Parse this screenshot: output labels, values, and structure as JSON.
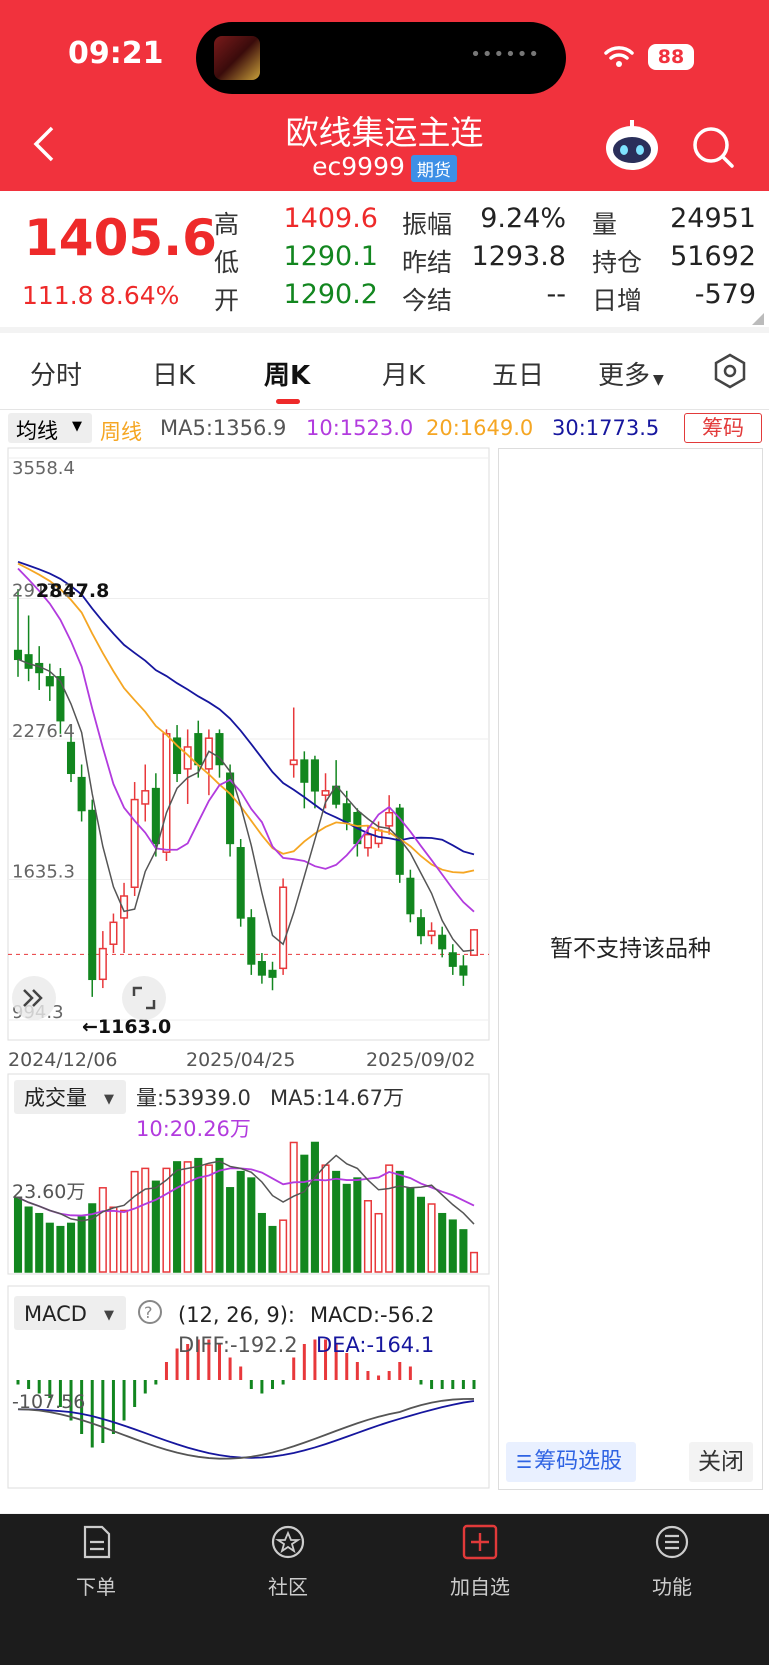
{
  "status_bar": {
    "time": "09:21",
    "battery": "88"
  },
  "header": {
    "title": "欧线集运主连",
    "code": "ec9999",
    "badge": "期货"
  },
  "quote": {
    "price": "1405.6",
    "change": "111.8",
    "change_pct": "8.64%",
    "rows": [
      {
        "l1": "高",
        "v1": "1409.6",
        "l2": "振幅",
        "v2": "9.24%",
        "l3": "量",
        "v3": "24951"
      },
      {
        "l1": "低",
        "v1": "1290.1",
        "l2": "昨结",
        "v2": "1293.8",
        "l3": "持仓",
        "v3": "51692"
      },
      {
        "l1": "开",
        "v1": "1290.2",
        "l2": "今结",
        "v2": "--",
        "l3": "日增",
        "v3": "-579"
      }
    ]
  },
  "tabs": [
    "分时",
    "日K",
    "周K",
    "月K",
    "五日",
    "更多"
  ],
  "ma_bar": {
    "select": "均线",
    "period": "周线",
    "ma5": "MA5:1356.9",
    "ma10": "10:1523.0",
    "ma20": "20:1649.0",
    "ma30": "30:1773.5",
    "chips": "筹码"
  },
  "colors": {
    "brand": "#f1323d",
    "up": "#e8383b",
    "down": "#12861f",
    "ma5": "#555555",
    "ma10": "#b23bde",
    "ma20": "#f5a623",
    "ma30": "#16169e"
  },
  "kline": {
    "y_labels": [
      "3558.4",
      "2917.3",
      "2276.4",
      "1635.3",
      "994.3"
    ],
    "high_marker": "2847.8",
    "low_marker": "←1163.0",
    "dates": [
      "2024/12/06",
      "2025/04/25",
      "2025/09/02"
    ]
  },
  "volume": {
    "select": "成交量",
    "vol": "量:53939.0",
    "ma5": "MA5:14.67万",
    "ma10": "10:20.26万",
    "y_label": "23.60万"
  },
  "macd": {
    "select": "MACD",
    "params": "(12, 26, 9):",
    "macd": "MACD:-56.2",
    "diff": "DIFF:-192.2",
    "dea": "DEA:-164.1",
    "y_label": "-107.56"
  },
  "right_panel": {
    "message": "暂不支持该品种",
    "chip_select": "筹码选股",
    "close": "关闭"
  },
  "nav": [
    {
      "label": "下单",
      "icon": "order-doc-icon"
    },
    {
      "label": "社区",
      "icon": "community-star-icon"
    },
    {
      "label": "加自选",
      "icon": "add-watchlist-icon"
    },
    {
      "label": "功能",
      "icon": "menu-lines-icon"
    }
  ],
  "chart_data": {
    "type": "candlestick",
    "y_range": [
      994.3,
      3558.4
    ],
    "candles": [
      {
        "o": 2680,
        "c": 2640,
        "h": 2960,
        "l": 2560
      },
      {
        "o": 2660,
        "c": 2600,
        "h": 2840,
        "l": 2540
      },
      {
        "o": 2620,
        "c": 2580,
        "h": 2700,
        "l": 2500
      },
      {
        "o": 2560,
        "c": 2520,
        "h": 2620,
        "l": 2450
      },
      {
        "o": 2560,
        "c": 2360,
        "h": 2600,
        "l": 2300
      },
      {
        "o": 2260,
        "c": 2120,
        "h": 2340,
        "l": 2080
      },
      {
        "o": 2100,
        "c": 1950,
        "h": 2160,
        "l": 1900
      },
      {
        "o": 1950,
        "c": 1180,
        "h": 2000,
        "l": 1100
      },
      {
        "o": 1180,
        "c": 1320,
        "h": 1400,
        "l": 1140
      },
      {
        "o": 1340,
        "c": 1440,
        "h": 1480,
        "l": 1300
      },
      {
        "o": 1460,
        "c": 1560,
        "h": 1620,
        "l": 1300
      },
      {
        "o": 1600,
        "c": 2000,
        "h": 2080,
        "l": 1560
      },
      {
        "o": 1980,
        "c": 2040,
        "h": 2160,
        "l": 1900
      },
      {
        "o": 2050,
        "c": 1800,
        "h": 2120,
        "l": 1740
      },
      {
        "o": 1760,
        "c": 2300,
        "h": 2320,
        "l": 1720
      },
      {
        "o": 2280,
        "c": 2120,
        "h": 2340,
        "l": 2080
      },
      {
        "o": 2140,
        "c": 2240,
        "h": 2320,
        "l": 1980
      },
      {
        "o": 2300,
        "c": 2160,
        "h": 2360,
        "l": 2100
      },
      {
        "o": 2140,
        "c": 2280,
        "h": 2320,
        "l": 2020
      },
      {
        "o": 2300,
        "c": 2160,
        "h": 2320,
        "l": 2100
      },
      {
        "o": 2120,
        "c": 1800,
        "h": 2160,
        "l": 1740
      },
      {
        "o": 1780,
        "c": 1460,
        "h": 1820,
        "l": 1420
      },
      {
        "o": 1460,
        "c": 1250,
        "h": 1500,
        "l": 1200
      },
      {
        "o": 1260,
        "c": 1200,
        "h": 1300,
        "l": 1160
      },
      {
        "o": 1220,
        "c": 1190,
        "h": 1260,
        "l": 1130
      },
      {
        "o": 1230,
        "c": 1600,
        "h": 1640,
        "l": 1200
      },
      {
        "o": 2160,
        "c": 2180,
        "h": 2420,
        "l": 2100
      },
      {
        "o": 2180,
        "c": 2080,
        "h": 2220,
        "l": 1960
      },
      {
        "o": 2180,
        "c": 2040,
        "h": 2200,
        "l": 1960
      },
      {
        "o": 2020,
        "c": 2040,
        "h": 2120,
        "l": 1960
      },
      {
        "o": 2060,
        "c": 1980,
        "h": 2180,
        "l": 1960
      },
      {
        "o": 1980,
        "c": 1900,
        "h": 2040,
        "l": 1860
      },
      {
        "o": 1940,
        "c": 1800,
        "h": 1960,
        "l": 1740
      },
      {
        "o": 1780,
        "c": 1840,
        "h": 1880,
        "l": 1740
      },
      {
        "o": 1800,
        "c": 1860,
        "h": 1900,
        "l": 1780
      },
      {
        "o": 1880,
        "c": 1940,
        "h": 2020,
        "l": 1840
      },
      {
        "o": 1960,
        "c": 1660,
        "h": 1980,
        "l": 1620
      },
      {
        "o": 1640,
        "c": 1480,
        "h": 1680,
        "l": 1440
      },
      {
        "o": 1460,
        "c": 1380,
        "h": 1500,
        "l": 1340
      },
      {
        "o": 1380,
        "c": 1400,
        "h": 1440,
        "l": 1340
      },
      {
        "o": 1380,
        "c": 1320,
        "h": 1420,
        "l": 1280
      },
      {
        "o": 1300,
        "c": 1240,
        "h": 1340,
        "l": 1200
      },
      {
        "o": 1240,
        "c": 1200,
        "h": 1290,
        "l": 1150
      },
      {
        "o": 1290,
        "c": 1405.6,
        "h": 1409.6,
        "l": 1290.1
      }
    ],
    "volumes": [
      23,
      20,
      18,
      15,
      14,
      15,
      17,
      21,
      26,
      20,
      19,
      31,
      32,
      28,
      32,
      34,
      34,
      35,
      33,
      35,
      26,
      31,
      29,
      18,
      14,
      16,
      40,
      36,
      40,
      33,
      31,
      27,
      29,
      22,
      18,
      33,
      31,
      26,
      23,
      21,
      18,
      16,
      13,
      6
    ],
    "vol_max": 42,
    "macd_hist": [
      -5,
      -10,
      -15,
      -20,
      -30,
      -45,
      -60,
      -75,
      -70,
      -60,
      -45,
      -30,
      -15,
      -5,
      20,
      35,
      40,
      45,
      45,
      40,
      25,
      15,
      -10,
      -15,
      -10,
      -5,
      25,
      40,
      45,
      45,
      40,
      30,
      20,
      10,
      5,
      10,
      20,
      15,
      -5,
      -10,
      -10,
      -10,
      -10,
      -10
    ]
  }
}
